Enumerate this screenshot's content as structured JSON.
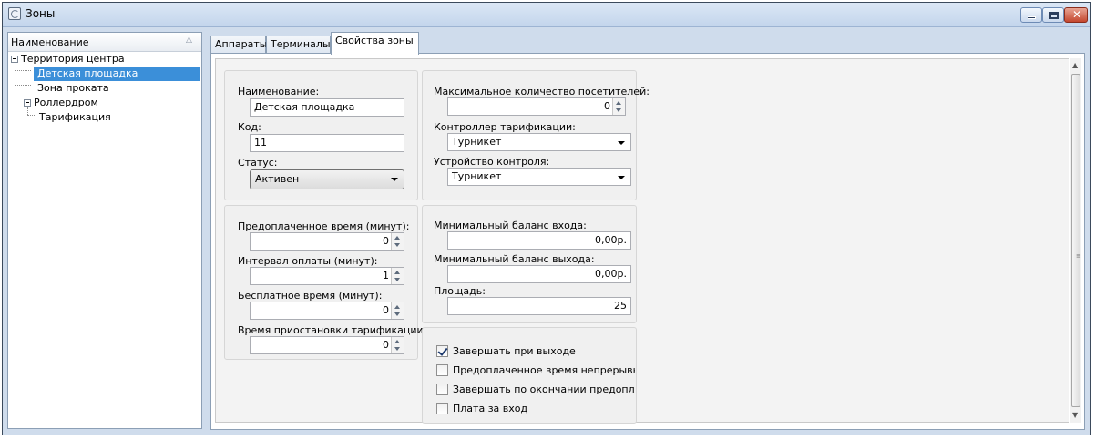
{
  "window": {
    "title": "Зоны"
  },
  "tree": {
    "header": "Наименование",
    "sort_glyph": "△",
    "items": [
      {
        "label": "Территория центра"
      },
      {
        "label": "Детская площадка"
      },
      {
        "label": "Зона проката"
      },
      {
        "label": "Роллердром"
      },
      {
        "label": "Тарификация"
      }
    ]
  },
  "tabs": [
    {
      "label": "Аппараты"
    },
    {
      "label": "Терминалы"
    },
    {
      "label": "Свойства зоны"
    }
  ],
  "form": {
    "name_label": "Наименование:",
    "name_value": "Детская площадка",
    "code_label": "Код:",
    "code_value": "11",
    "status_label": "Статус:",
    "status_value": "Активен",
    "max_visitors_label": "Максимальное количество посетителей:",
    "max_visitors_value": "0",
    "tariff_controller_label": "Контроллер тарификации:",
    "tariff_controller_value": "Турникет",
    "control_device_label": "Устройство контроля:",
    "control_device_value": "Турникет",
    "prepaid_time_label": "Предоплаченное время (минут):",
    "prepaid_time_value": "0",
    "payment_interval_label": "Интервал оплаты (минут):",
    "payment_interval_value": "1",
    "free_time_label": "Бесплатное время (минут):",
    "free_time_value": "0",
    "suspend_time_label": "Время приостановки тарификации:",
    "suspend_time_value": "0",
    "min_entry_balance_label": "Минимальный баланс входа:",
    "min_entry_balance_value": "0,00р.",
    "min_exit_balance_label": "Минимальный баланс выхода:",
    "min_exit_balance_value": "0,00р.",
    "area_label": "Площадь:",
    "area_value": "25",
    "checkboxes": [
      {
        "label": "Завершать при выходе",
        "checked": true
      },
      {
        "label": "Предоплаченное время непрерывно",
        "checked": false
      },
      {
        "label": "Завершать по окончании предоплаты",
        "checked": false
      },
      {
        "label": "Плата за вход",
        "checked": false
      }
    ]
  },
  "colors": {
    "selection": "#3b8fd9",
    "frame": "#cfdcec"
  }
}
